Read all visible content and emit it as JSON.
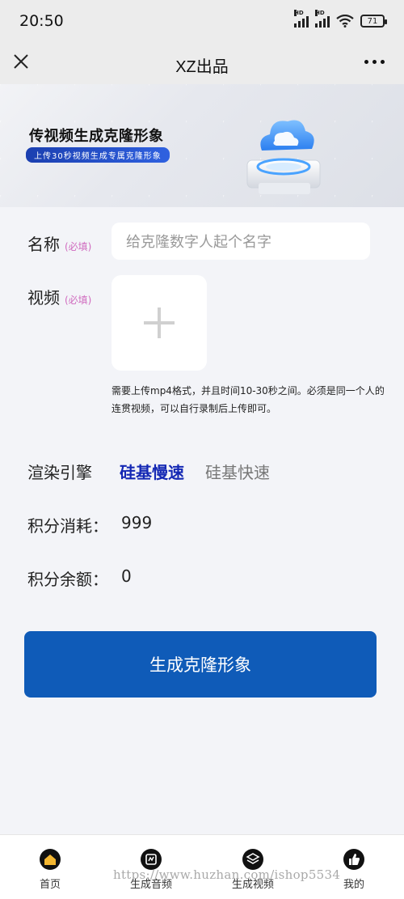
{
  "status_bar": {
    "time": "20:50",
    "battery": "71",
    "network_label": "HD"
  },
  "nav": {
    "title": "XZ出品",
    "close_icon": "close-icon",
    "more_icon": "more-horizontal-icon"
  },
  "banner": {
    "title": "传视频生成克隆形象",
    "subtitle": "上传30秒视频生成专属克隆形象"
  },
  "form": {
    "name_label": "名称",
    "name_required": "(必填)",
    "name_placeholder": "给克隆数字人起个名字",
    "video_label": "视频",
    "video_required": "(必填)",
    "upload_hint": "需要上传mp4格式，并且时间10-30秒之间。必须是同一个人的连贯视频，可以自行录制后上传即可。",
    "engine_label": "渲染引擎",
    "engine_options": [
      "硅基慢速",
      "硅基快速"
    ],
    "engine_selected": "硅基慢速",
    "cost_label": "积分消耗：",
    "cost_value": "999",
    "balance_label": "积分余额：",
    "balance_value": "0",
    "submit_label": "生成克隆形象"
  },
  "tabbar": {
    "items": [
      {
        "label": "首页",
        "icon": "home-icon"
      },
      {
        "label": "生成音频",
        "icon": "audio-icon"
      },
      {
        "label": "生成视频",
        "icon": "layers-icon"
      },
      {
        "label": "我的",
        "icon": "thumbs-up-icon"
      }
    ]
  },
  "watermark": "https://www.huzhan.com/ishop5534",
  "colors": {
    "accent": "#0f5bb8",
    "engine_active": "#1428b4",
    "required": "#d06bbf",
    "background": "#f3f4f8"
  }
}
